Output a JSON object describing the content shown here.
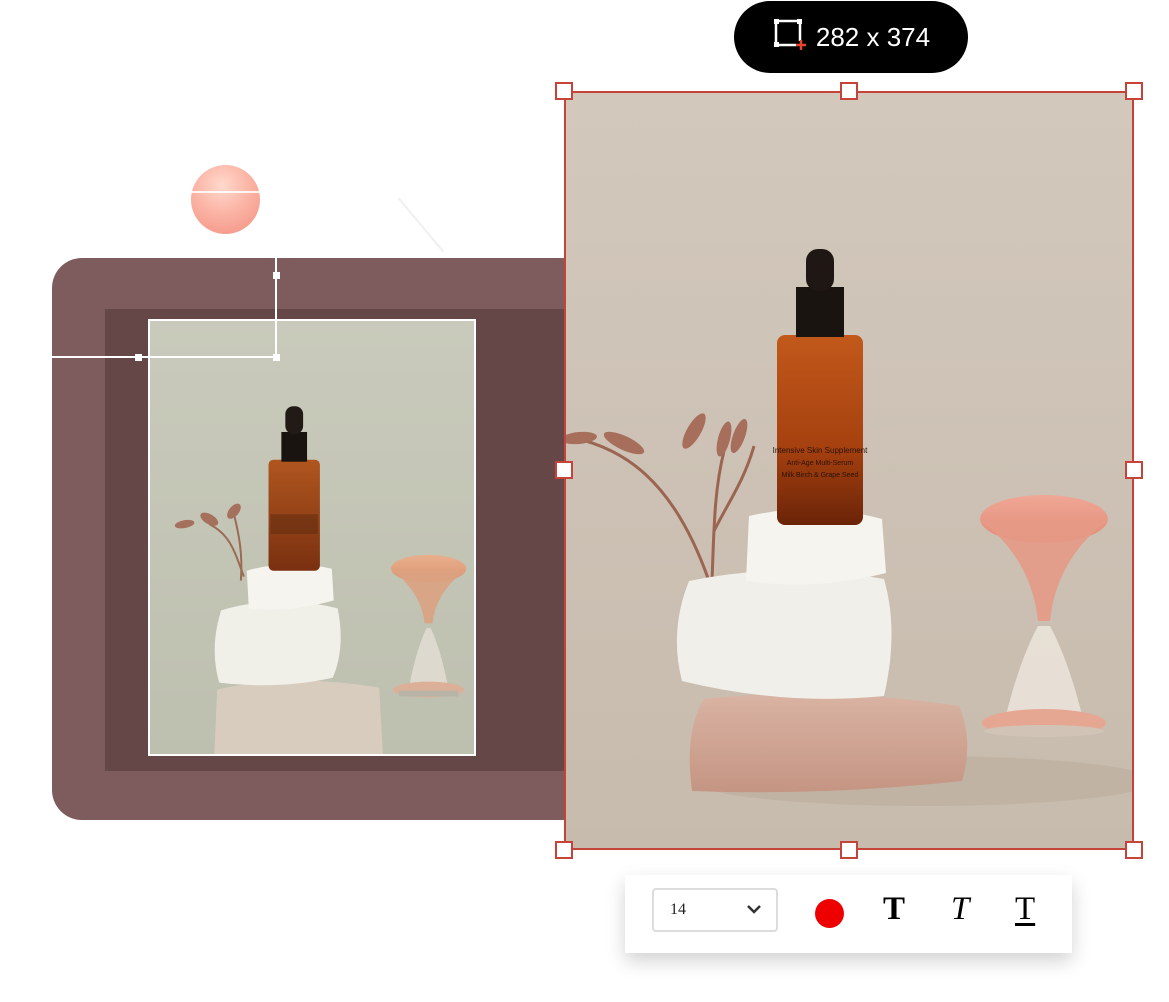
{
  "size_badge": {
    "icon": "crop-add-icon",
    "label": "282 x 374"
  },
  "toolbar": {
    "font_size": "14",
    "text_color": "#ee0000",
    "bold_icon": "T",
    "italic_icon": "T",
    "underline_icon": "T"
  },
  "colors": {
    "selection_frame": "#c6433a",
    "panel": "#7e5b5c",
    "panel_inner": "#664747",
    "badge": "#000000"
  },
  "bottle_label": {
    "line1": "Intensive Skin Supplement",
    "line2": "Anti-Age Multi-Serum",
    "line3": "Milk Birch & Grape Seed"
  }
}
